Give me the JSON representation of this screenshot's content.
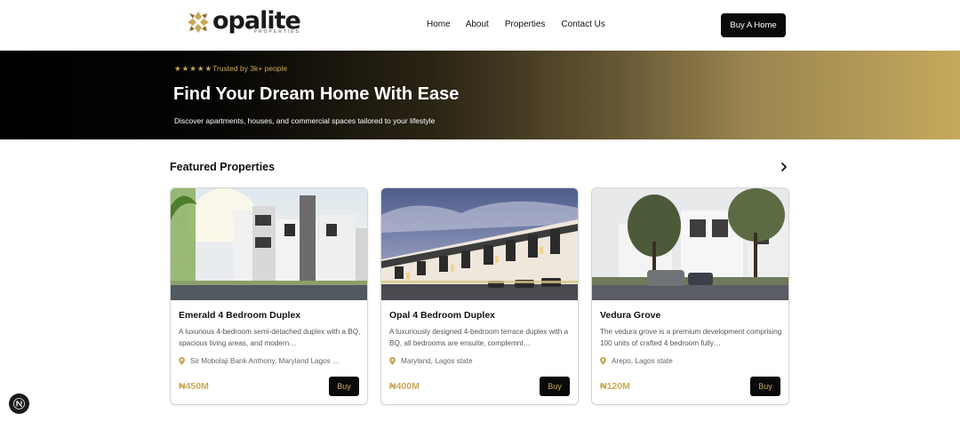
{
  "brand": {
    "name": "opalite",
    "tagline": "PROPERTIES"
  },
  "nav": {
    "items": [
      {
        "label": "Home"
      },
      {
        "label": "About"
      },
      {
        "label": "Properties"
      },
      {
        "label": "Contact Us"
      }
    ],
    "cta_label": "Buy A Home"
  },
  "hero": {
    "stars": "★★★★★",
    "trusted": "Trusted by 3k+ people",
    "title": "Find Your Dream Home With Ease",
    "subtitle": "Discover apartments, houses, and commercial spaces tailored to your lifestyle"
  },
  "featured": {
    "title": "Featured Properties",
    "cards": [
      {
        "title": "Emerald 4 Bedroom Duplex",
        "description": "A luxurious 4-bedroom semi-detached duplex with a BQ, spacious living areas, and modern…",
        "location": "Sir Mobolaji Bank Anthony, Maryland Lagos …",
        "price": "₦450M",
        "buy_label": "Buy"
      },
      {
        "title": "Opal 4 Bedroom Duplex",
        "description": "A luxuriously designed 4-bedroom terrace duplex with a BQ, all bedrooms are ensuite, complemnt…",
        "location": "Maryland, Lagos state",
        "price": "₦400M",
        "buy_label": "Buy"
      },
      {
        "title": "Vedura Grove",
        "description": "The vedura grove is a premium development comprising 100 units of crafted 4 bedroom fully…",
        "location": "Arepo, Lagos state",
        "price": "₦120M",
        "buy_label": "Buy"
      }
    ]
  },
  "colors": {
    "accent": "#c9a85a",
    "dark": "#0a0a0a"
  }
}
